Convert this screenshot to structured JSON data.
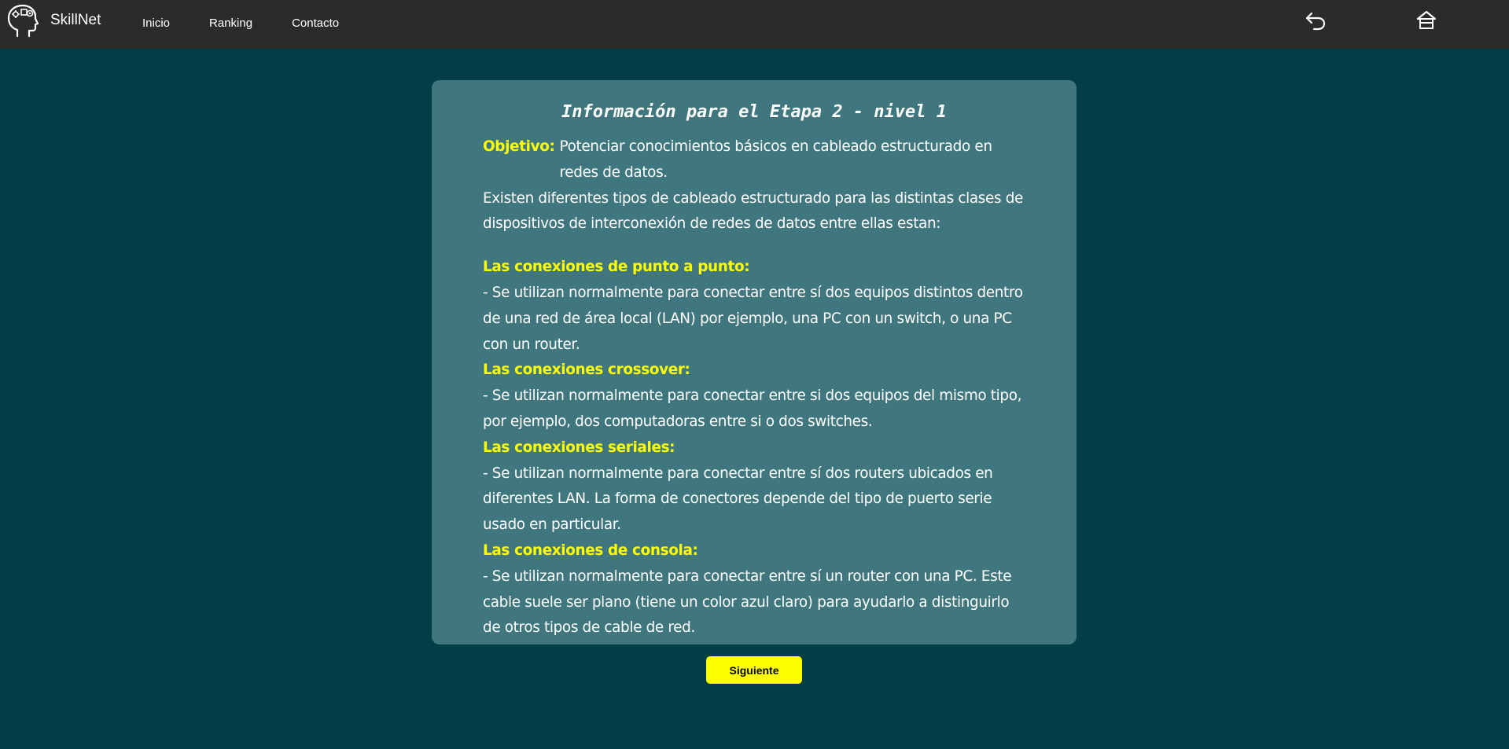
{
  "navbar": {
    "brand_name": "SkillNet",
    "links": [
      "Inicio",
      "Ranking",
      "Contacto"
    ],
    "icons": {
      "back": "undo-arrow-icon",
      "home": "home-icon",
      "logo": "brain-head-logo"
    }
  },
  "card": {
    "title": "Información para el Etapa 2 - nivel 1",
    "objective_label": "Objetivo:",
    "objective_text": "Potenciar conocimientos básicos en cableado estructurado en redes de datos.",
    "intro": "Existen diferentes tipos de cableado estructurado para las distintas clases de dispositivos de interconexión de redes de datos entre ellas estan:",
    "sections": [
      {
        "heading": "Las conexiones de punto a punto:",
        "body": "- Se utilizan normalmente para conectar entre sí dos equipos distintos dentro de una red de área local (LAN) por ejemplo, una PC con un switch, o una PC con un router."
      },
      {
        "heading": "Las conexiones crossover:",
        "body": "- Se utilizan normalmente para conectar entre si dos equipos del mismo tipo, por ejemplo, dos computadoras entre si o dos switches."
      },
      {
        "heading": "Las conexiones seriales:",
        "body": "- Se utilizan normalmente para conectar entre sí dos routers ubicados en diferentes LAN. La forma de conectores depende del tipo de puerto serie usado en particular."
      },
      {
        "heading": "Las conexiones de consola:",
        "body": "- Se utilizan normalmente para conectar entre sí un router con una PC. Este cable suele ser plano (tiene un color azul claro) para ayudarlo a distinguirlo de otros tipos de cable de red."
      }
    ]
  },
  "next_button_label": "Siguiente",
  "colors": {
    "page_background": "#023e45",
    "navbar_background": "#2b2b2b",
    "card_background": "#40777e",
    "accent_yellow": "#ffff00"
  }
}
